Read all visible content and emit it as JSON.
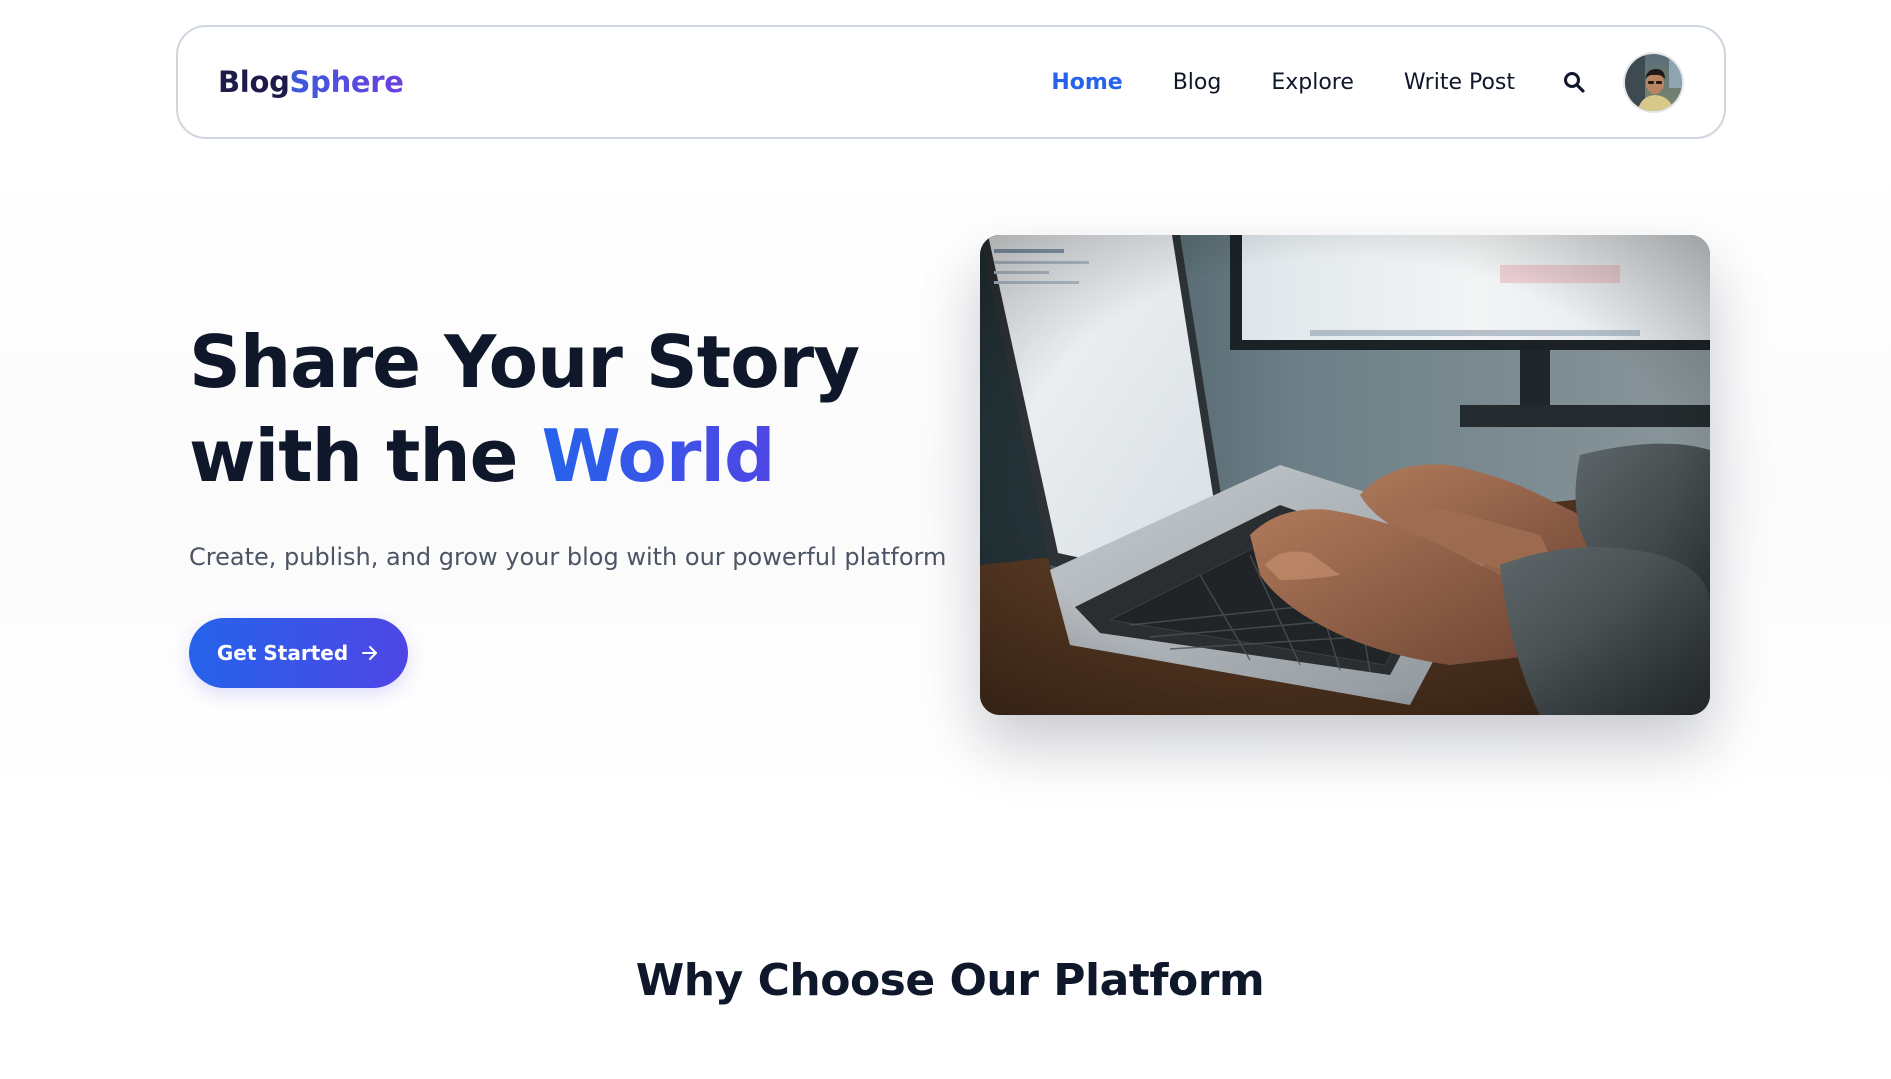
{
  "brand": {
    "name_part1": "Blog",
    "name_part2": "Sphere"
  },
  "nav": {
    "items": [
      {
        "label": "Home",
        "active": true
      },
      {
        "label": "Blog",
        "active": false
      },
      {
        "label": "Explore",
        "active": false
      },
      {
        "label": "Write Post",
        "active": false
      }
    ],
    "search_icon": "search-icon",
    "avatar_icon": "user-avatar-photo"
  },
  "hero": {
    "title_line1": "Share Your Story",
    "title_line2_prefix": "with the ",
    "title_line2_accent": "World",
    "subtitle": "Create, publish, and grow your blog with our powerful platform",
    "cta_label": "Get Started",
    "cta_icon": "arrow-right-icon",
    "image_icon": "laptop-typing-photo"
  },
  "features": {
    "title": "Why Choose Our Platform"
  },
  "colors": {
    "accent": "#2563eb",
    "accent_end": "#4f46e5",
    "text_dark": "#0f172a",
    "text_muted": "#4b5563",
    "nav_border": "#cfd6e0"
  }
}
